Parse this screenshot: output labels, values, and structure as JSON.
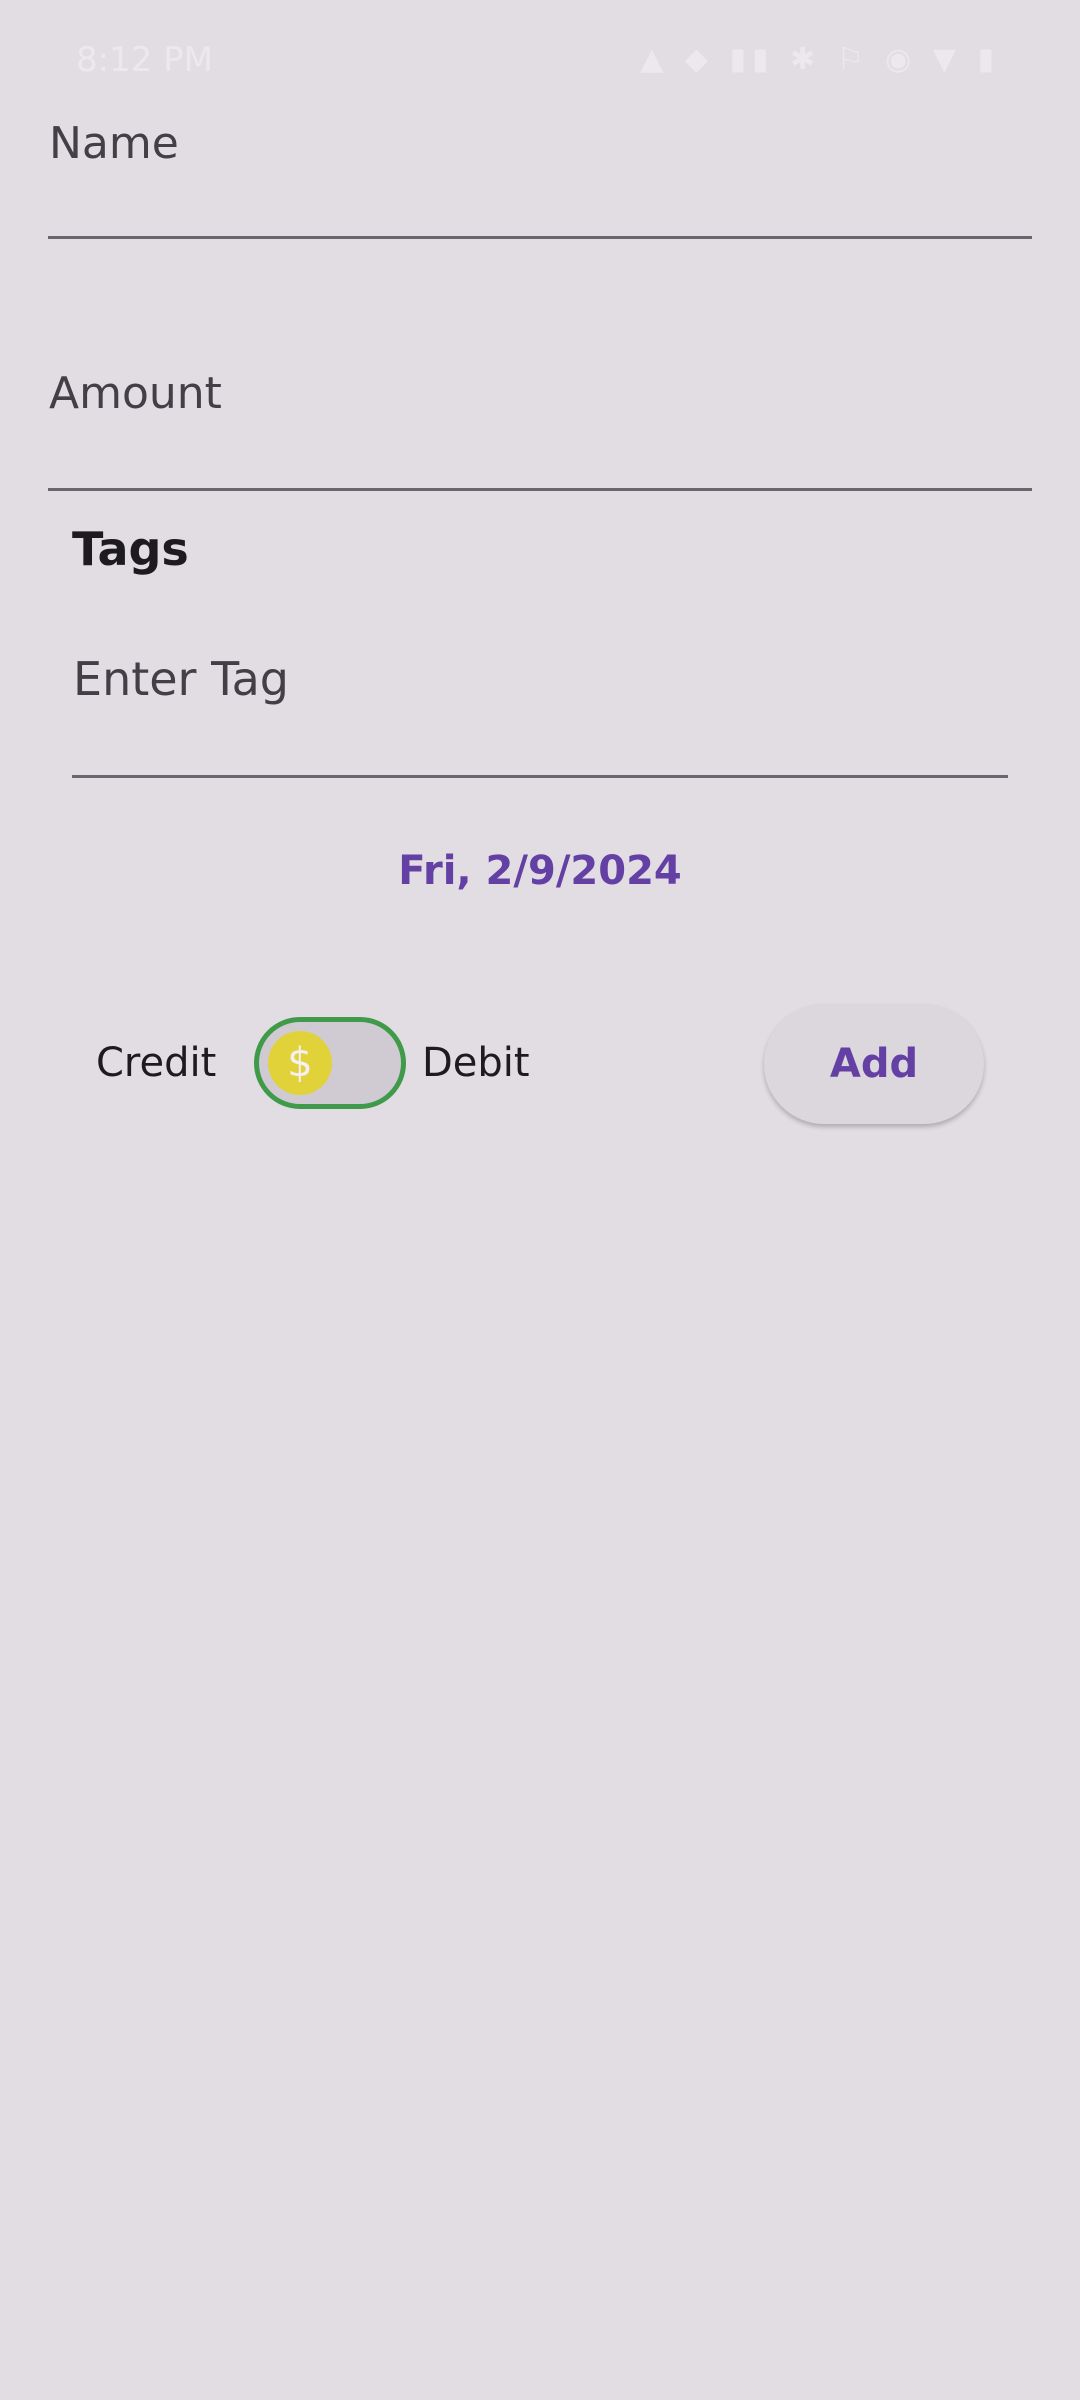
{
  "status_bar": {
    "time": "8:12 PM",
    "icons": "▲ ◆ ▮▮ ✱ ⚐ ◉ ▼ ▮"
  },
  "form": {
    "name": {
      "placeholder": "Name",
      "value": ""
    },
    "amount": {
      "placeholder": "Amount",
      "value": ""
    },
    "tags": {
      "title": "Tags",
      "input_placeholder": "Enter Tag"
    },
    "date": "Fri, 2/9/2024",
    "type_toggle": {
      "left_label": "Credit",
      "right_label": "Debit",
      "thumb_glyph": "$",
      "selected": "Credit"
    },
    "add_label": "Add"
  },
  "colors": {
    "background": "#e1dde2",
    "accent": "#6440a5",
    "switch_border": "#3f9a4a",
    "switch_thumb": "#e2d23a"
  }
}
